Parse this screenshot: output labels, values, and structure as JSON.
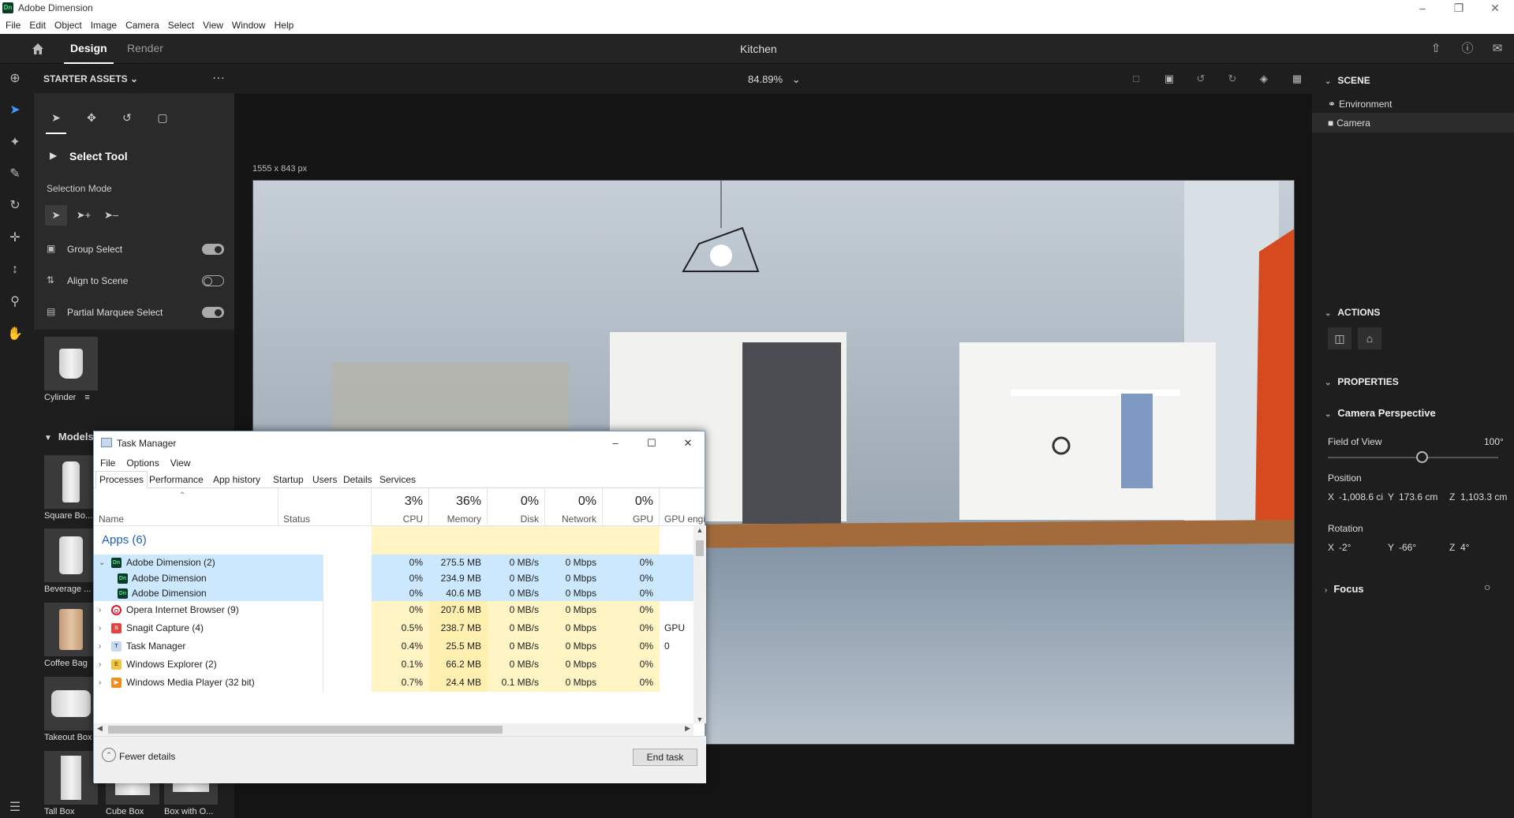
{
  "window": {
    "title": "Adobe Dimension",
    "logo": "Dn"
  },
  "menu": [
    "File",
    "Edit",
    "Object",
    "Image",
    "Camera",
    "Select",
    "View",
    "Window",
    "Help"
  ],
  "topbar": {
    "tab_design": "Design",
    "tab_render": "Render",
    "document": "Kitchen"
  },
  "left": {
    "header": "STARTER ASSETS",
    "tool_name": "Select Tool",
    "selection_mode_label": "Selection Mode",
    "options": [
      {
        "label": "Group Select",
        "on": true
      },
      {
        "label": "Align to Scene",
        "on": false
      },
      {
        "label": "Partial Marquee Select",
        "on": true
      }
    ],
    "cylinder": "Cylinder",
    "models_header": "Models",
    "models": [
      "Square Bo...",
      "Beverage ...",
      "Coffee Bag",
      "Takeout Box",
      "Tall Box",
      "Cube Box",
      "Box with O..."
    ]
  },
  "canvas": {
    "zoom": "84.89%",
    "dimensions": "1555 x 843 px"
  },
  "right": {
    "scene_header": "SCENE",
    "environment": "Environment",
    "camera": "Camera",
    "actions_header": "ACTIONS",
    "properties_header": "PROPERTIES",
    "camera_perspective": "Camera Perspective",
    "fov_label": "Field of View",
    "fov_value": "100°",
    "fov_fraction": 0.55,
    "position_label": "Position",
    "pos_x": "-1,008.6 ci",
    "pos_y": "173.6 cm",
    "pos_z": "1,103.3 cm",
    "rotation_label": "Rotation",
    "rot_x": "-2°",
    "rot_y": "-66°",
    "rot_z": "4°",
    "focus": "Focus",
    "axis_x": "X",
    "axis_y": "Y",
    "axis_z": "Z"
  },
  "task_manager": {
    "title": "Task Manager",
    "menu": [
      "File",
      "Options",
      "View"
    ],
    "tabs": [
      "Processes",
      "Performance",
      "App history",
      "Startup",
      "Users",
      "Details",
      "Services"
    ],
    "columns": {
      "name": "Name",
      "status": "Status",
      "cpu_pct": "3%",
      "cpu": "CPU",
      "mem_pct": "36%",
      "mem": "Memory",
      "disk_pct": "0%",
      "disk": "Disk",
      "net_pct": "0%",
      "net": "Network",
      "gpu_pct": "0%",
      "gpu": "GPU",
      "gpu_engine": "GPU engi"
    },
    "group": "Apps (6)",
    "rows": [
      {
        "name": "Adobe Dimension (2)",
        "cpu": "0%",
        "mem": "275.5 MB",
        "disk": "0 MB/s",
        "net": "0 Mbps",
        "gpu": "0%",
        "engine": ""
      },
      {
        "name": "Adobe Dimension",
        "cpu": "0%",
        "mem": "234.9 MB",
        "disk": "0 MB/s",
        "net": "0 Mbps",
        "gpu": "0%",
        "engine": ""
      },
      {
        "name": "Adobe Dimension",
        "cpu": "0%",
        "mem": "40.6 MB",
        "disk": "0 MB/s",
        "net": "0 Mbps",
        "gpu": "0%",
        "engine": ""
      },
      {
        "name": "Opera Internet Browser (9)",
        "cpu": "0%",
        "mem": "207.6 MB",
        "disk": "0 MB/s",
        "net": "0 Mbps",
        "gpu": "0%",
        "engine": ""
      },
      {
        "name": "Snagit Capture (4)",
        "cpu": "0.5%",
        "mem": "238.7 MB",
        "disk": "0 MB/s",
        "net": "0 Mbps",
        "gpu": "0%",
        "engine": "GPU 0"
      },
      {
        "name": "Task Manager",
        "cpu": "0.4%",
        "mem": "25.5 MB",
        "disk": "0 MB/s",
        "net": "0 Mbps",
        "gpu": "0%",
        "engine": ""
      },
      {
        "name": "Windows Explorer (2)",
        "cpu": "0.1%",
        "mem": "66.2 MB",
        "disk": "0 MB/s",
        "net": "0 Mbps",
        "gpu": "0%",
        "engine": ""
      },
      {
        "name": "Windows Media Player (32 bit)",
        "cpu": "0.7%",
        "mem": "24.4 MB",
        "disk": "0.1 MB/s",
        "net": "0 Mbps",
        "gpu": "0%",
        "engine": ""
      }
    ],
    "fewer_details": "Fewer details",
    "end_task": "End task"
  }
}
